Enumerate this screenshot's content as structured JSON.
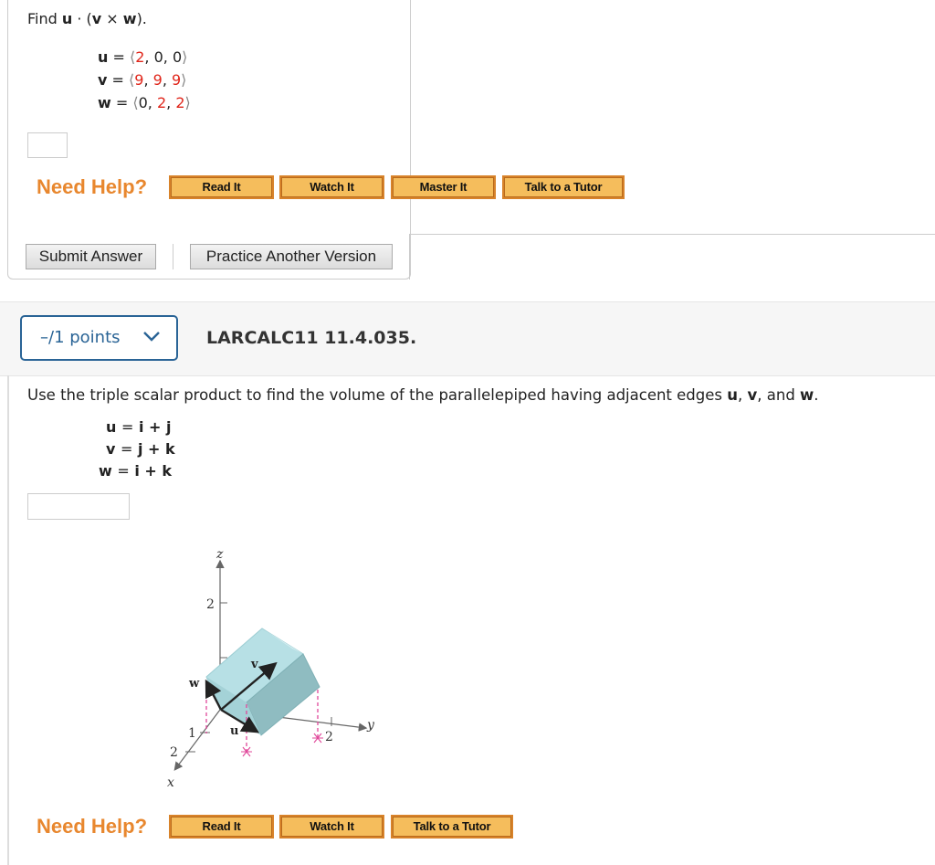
{
  "q1": {
    "prompt_prefix": "Find ",
    "prompt_u": "u",
    "prompt_dot": " · (",
    "prompt_v": "v",
    "prompt_cross": " × ",
    "prompt_w": "w",
    "prompt_end": ").",
    "vectors": [
      {
        "name": "u",
        "components": [
          "2",
          "0",
          "0"
        ],
        "highlight": [
          true,
          false,
          false
        ]
      },
      {
        "name": "v",
        "components": [
          "9",
          "9",
          "9"
        ],
        "highlight": [
          true,
          true,
          true
        ]
      },
      {
        "name": "w",
        "components": [
          "0",
          "2",
          "2"
        ],
        "highlight": [
          false,
          true,
          true
        ]
      }
    ],
    "answer_value": "",
    "need_help": "Need Help?",
    "help_buttons": [
      "Read It",
      "Watch It",
      "Master It",
      "Talk to a Tutor"
    ],
    "submit_label": "Submit Answer",
    "practice_label": "Practice Another Version"
  },
  "q2": {
    "points_label": "–/1 points",
    "question_id": "LARCALC11 11.4.035.",
    "prompt_a": "Use the triple scalar product to find the volume of the parallelepiped having adjacent edges ",
    "prompt_u": "u",
    "prompt_sep1": ", ",
    "prompt_v": "v",
    "prompt_sep2": ", and ",
    "prompt_w": "w",
    "prompt_end": ".",
    "vectors": [
      {
        "name": "u",
        "expr": "i + j"
      },
      {
        "name": "v",
        "expr": "j + k"
      },
      {
        "name": "w",
        "expr": "i + k"
      }
    ],
    "answer_value": "",
    "figure": {
      "axis_x": "x",
      "axis_y": "y",
      "axis_z": "z",
      "tick_z2": "2",
      "tick_x1": "1",
      "tick_x2": "2",
      "tick_y2": "2",
      "label_u": "u",
      "label_v": "v",
      "label_w": "w"
    },
    "need_help": "Need Help?",
    "help_buttons": [
      "Read It",
      "Watch It",
      "Talk to a Tutor"
    ]
  },
  "colors": {
    "accent_blue": "#2a6496",
    "help_orange": "#e8872e",
    "highlight_red": "#e0261b",
    "box_fill": "#a9d8de"
  }
}
